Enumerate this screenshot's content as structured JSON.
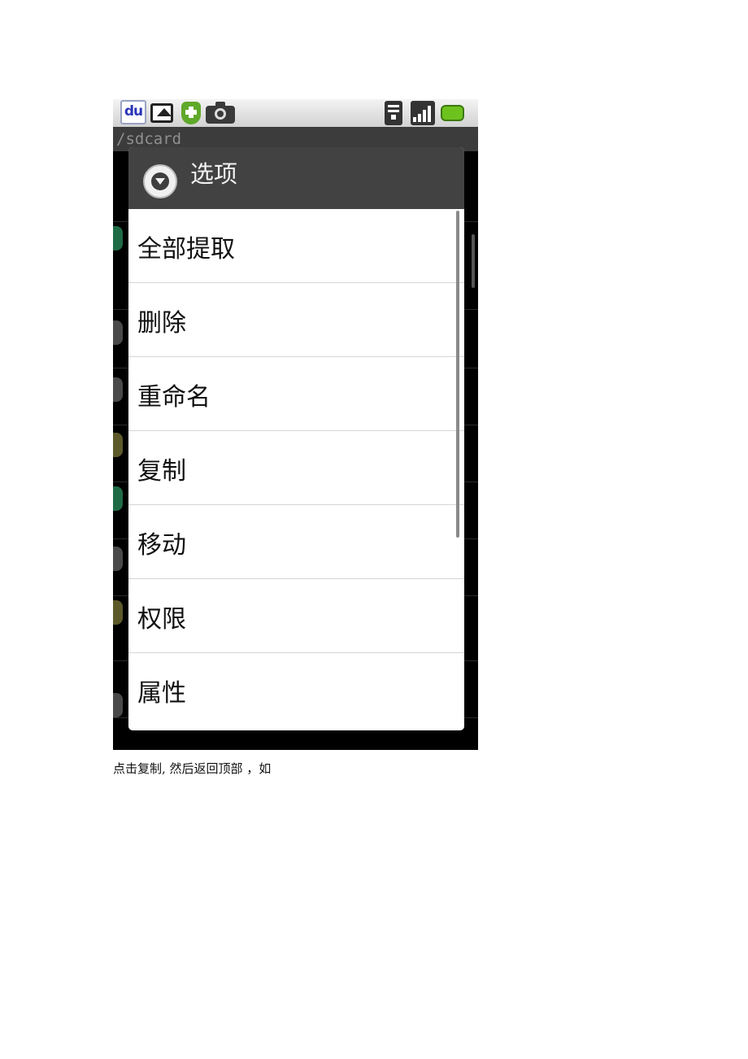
{
  "statusbar": {
    "app_icon_text": "du",
    "icons": [
      "baidu-icon",
      "gallery-icon",
      "shield-icon",
      "camera-icon",
      "wifi-icon",
      "signal-icon",
      "battery-icon"
    ]
  },
  "path": "/sdcard",
  "dialog": {
    "title": "选项",
    "items": [
      {
        "label": "全部提取"
      },
      {
        "label": "删除"
      },
      {
        "label": "重命名"
      },
      {
        "label": "复制"
      },
      {
        "label": "移动"
      },
      {
        "label": "权限"
      },
      {
        "label": "属性"
      }
    ]
  },
  "caption": "点击复制,  然后返回顶部 ，如",
  "colors": {
    "dialog_header": "#424242",
    "background": "#000000",
    "battery": "#6ec21e"
  }
}
